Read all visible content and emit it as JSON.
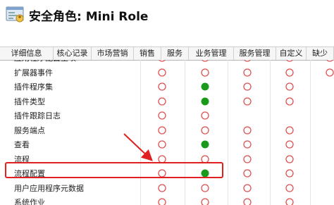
{
  "window": {
    "title": "安全角色: Mini Role"
  },
  "tabs": [
    {
      "label": "详细信息"
    },
    {
      "label": "核心记录"
    },
    {
      "label": "市场营销"
    },
    {
      "label": "销售"
    },
    {
      "label": "服务"
    },
    {
      "label": "业务管理"
    },
    {
      "label": "服务管理"
    },
    {
      "label": "自定义"
    },
    {
      "label": "缺少"
    }
  ],
  "rows": [
    {
      "label": "应用程序配置主项",
      "cells": [
        "none",
        "none",
        "none",
        "none",
        "none"
      ]
    },
    {
      "label": "扩展器事件",
      "cells": [
        "none",
        "none",
        "none",
        "none",
        "none"
      ]
    },
    {
      "label": "插件程序集",
      "cells": [
        "none",
        "full",
        "none",
        "none",
        "empty"
      ]
    },
    {
      "label": "插件类型",
      "cells": [
        "none",
        "full",
        "none",
        "none",
        "empty"
      ]
    },
    {
      "label": "插件跟踪日志",
      "cells": [
        "none",
        "none",
        "empty",
        "empty",
        "empty"
      ]
    },
    {
      "label": "服务端点",
      "cells": [
        "none",
        "none",
        "none",
        "none",
        "empty"
      ]
    },
    {
      "label": "查看",
      "cells": [
        "none",
        "full",
        "none",
        "none",
        "empty"
      ]
    },
    {
      "label": "流程",
      "cells": [
        "none",
        "none",
        "none",
        "none",
        "empty"
      ]
    },
    {
      "label": "流程配置",
      "cells": [
        "none",
        "full",
        "none",
        "none",
        "empty"
      ]
    },
    {
      "label": "用户应用程序元数据",
      "cells": [
        "none",
        "none",
        "none",
        "none",
        "empty"
      ]
    },
    {
      "label": "系统作业",
      "cells": [
        "none",
        "none",
        "none",
        "none",
        "empty"
      ]
    }
  ],
  "colors": {
    "none_circle": "#e05050",
    "full_dot": "#1a9a1a",
    "highlight": "#e02020",
    "arrow": "#e02020"
  }
}
